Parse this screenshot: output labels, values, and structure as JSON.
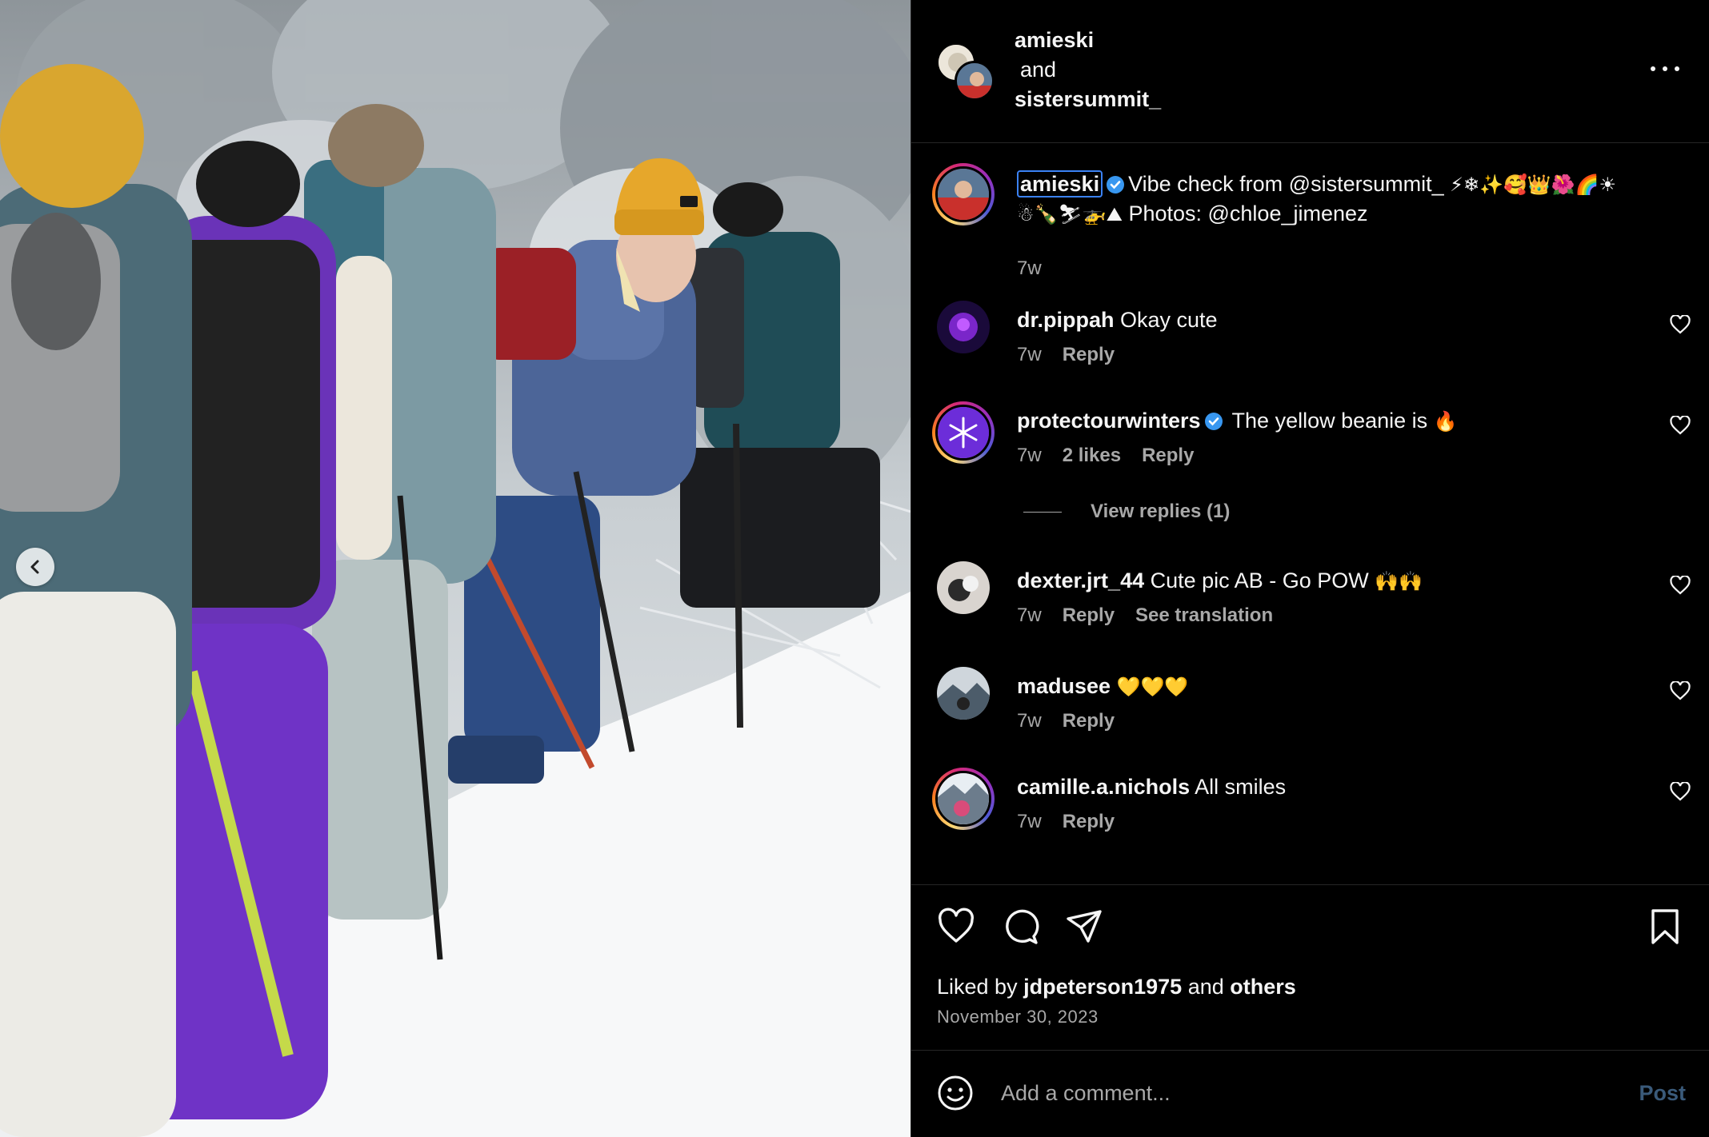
{
  "header": {
    "user1": "amieski",
    "joiner": "and",
    "user2": "sistersummit_"
  },
  "caption": {
    "username": "amieski",
    "text_line1": "Vibe check from @sistersummit_",
    "emoji_line1": "⚡❄✨🥰👑🌺🌈☀",
    "emoji_line2": "☃🍾⛷🚁⛰",
    "text_line2": "Photos: @chloe_jimenez",
    "time": "7w"
  },
  "comments": [
    {
      "username": "dr.pippah",
      "text": "Okay cute",
      "time": "7w",
      "reply": "Reply"
    },
    {
      "username": "protectourwinters",
      "text": "The yellow beanie is",
      "emoji": "🔥",
      "time": "7w",
      "likes": "2 likes",
      "reply": "Reply",
      "view_replies": "View replies (1)"
    },
    {
      "username": "dexter.jrt_44",
      "text": "Cute pic AB - Go POW",
      "emoji": "🙌🙌",
      "time": "7w",
      "reply": "Reply",
      "translation": "See translation"
    },
    {
      "username": "madusee",
      "text": "",
      "emoji": "💛💛💛",
      "time": "7w",
      "reply": "Reply"
    },
    {
      "username": "camille.a.nichols",
      "text": "All smiles",
      "time": "7w",
      "reply": "Reply"
    }
  ],
  "actions": {
    "liked_prefix": "Liked by",
    "liked_user": "jdpeterson1975",
    "liked_and": "and",
    "liked_others": "others",
    "date": "November 30, 2023"
  },
  "add_comment": {
    "placeholder": "Add a comment...",
    "post_label": "Post"
  },
  "icons": [
    "chevron-left-icon",
    "more-icon",
    "verified-icon",
    "heart-icon",
    "comment-icon",
    "share-icon",
    "bookmark-icon",
    "emoji-icon",
    "snowflake-icon"
  ],
  "colors": {
    "background": "#000000",
    "muted": "#a8a8a8",
    "verified": "#3897f0",
    "post_disabled": "#3a5a7a"
  }
}
